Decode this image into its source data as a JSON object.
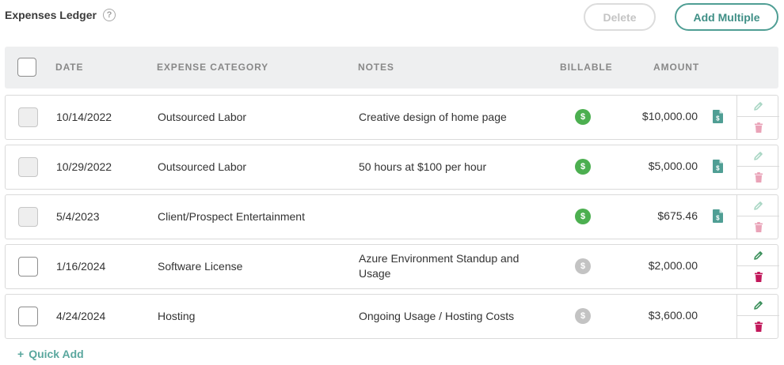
{
  "page": {
    "title": "Expenses Ledger",
    "help_icon": "?"
  },
  "toolbar": {
    "delete_label": "Delete",
    "add_multiple_label": "Add Multiple"
  },
  "table": {
    "headers": {
      "date": "DATE",
      "category": "EXPENSE CATEGORY",
      "notes": "NOTES",
      "billable": "BILLABLE",
      "amount": "AMOUNT"
    },
    "rows": [
      {
        "date": "10/14/2022",
        "category": "Outsourced Labor",
        "notes_line1": "Creative design of home page",
        "notes_line2": "",
        "billable": true,
        "amount": "$10,000.00",
        "has_receipt": true,
        "locked": true
      },
      {
        "date": "10/29/2022",
        "category": "Outsourced Labor",
        "notes_line1": "50 hours at $100 per hour",
        "notes_line2": "",
        "billable": true,
        "amount": "$5,000.00",
        "has_receipt": true,
        "locked": true
      },
      {
        "date": "5/4/2023",
        "category": "Client/Prospect Entertainment",
        "notes_line1": "",
        "notes_line2": "",
        "billable": true,
        "amount": "$675.46",
        "has_receipt": true,
        "locked": true
      },
      {
        "date": "1/16/2024",
        "category": "Software License",
        "notes_line1": "Azure Environment Standup and",
        "notes_line2": "Usage",
        "billable": false,
        "amount": "$2,000.00",
        "has_receipt": false,
        "locked": false
      },
      {
        "date": "4/24/2024",
        "category": "Hosting",
        "notes_line1": "Ongoing Usage / Hosting Costs",
        "notes_line2": "",
        "billable": false,
        "amount": "$3,600.00",
        "has_receipt": false,
        "locked": false
      }
    ],
    "billable_symbol": "$"
  },
  "footer": {
    "quick_add_plus": "+",
    "quick_add_label": "Quick Add"
  },
  "colors": {
    "accent": "#4f9e94",
    "billable_on": "#4caf50",
    "billable_off": "#c3c3c3",
    "edit_active": "#3a8f5a",
    "edit_inactive": "#a9d6c4",
    "trash_active": "#c2185b",
    "trash_inactive": "#eaa3b8",
    "receipt": "#4f9e94"
  },
  "icons": {
    "help": "help-circle-icon",
    "billable": "dollar-circle-icon",
    "receipt": "receipt-icon",
    "edit": "pencil-icon",
    "delete": "trash-icon"
  }
}
